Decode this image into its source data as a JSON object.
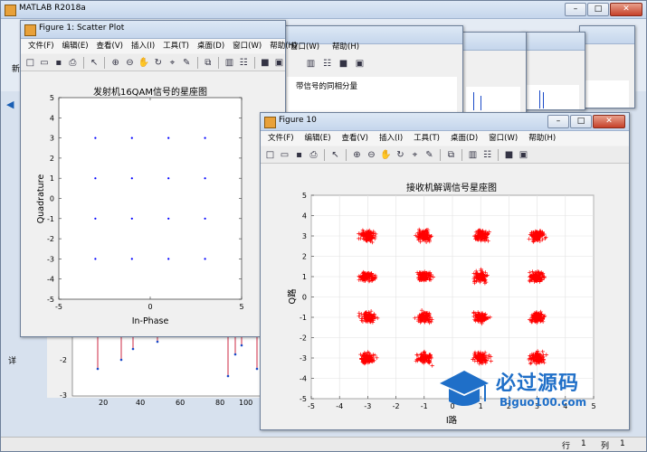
{
  "app": {
    "title": "MATLAB R2018a",
    "side_text": "新",
    "side_text2": "详"
  },
  "statusbar": {
    "row_label": "行",
    "row_value": "1",
    "col_label": "列",
    "col_value": "1"
  },
  "menu": {
    "file": "文件(F)",
    "edit": "编辑(E)",
    "view": "查看(V)",
    "insert": "插入(I)",
    "tools": "工具(T)",
    "desktop": "桌面(D)",
    "window": "窗口(W)",
    "help": "帮助(H)"
  },
  "bg_window": {
    "window_label": "窗口(W)",
    "help_label": "帮助(H)",
    "title": "带信号的同相分量"
  },
  "bg_stem": {
    "ticks_y": [
      "-2",
      "-3"
    ],
    "ticks_x": [
      "20",
      "40",
      "60",
      "80",
      "100"
    ]
  },
  "figure1": {
    "title": "Figure 1: Scatter Plot",
    "chart_data": {
      "type": "scatter",
      "title": "发射机16QAM信号的星座图",
      "xlabel": "In-Phase",
      "ylabel": "Quadrature",
      "xlim": [
        -5,
        5
      ],
      "ylim": [
        -5,
        5
      ],
      "xticks": [
        "-5",
        "0",
        "5"
      ],
      "yticks": [
        "5",
        "4",
        "3",
        "2",
        "1",
        "0",
        "-1",
        "-2",
        "-3",
        "-4",
        "-5"
      ],
      "x": [
        -3,
        -1,
        1,
        3,
        -3,
        -1,
        1,
        3,
        -3,
        -1,
        1,
        3,
        -3,
        -1,
        1,
        3
      ],
      "y": [
        3,
        3,
        3,
        3,
        1,
        1,
        1,
        1,
        -1,
        -1,
        -1,
        -1,
        -3,
        -3,
        -3,
        -3
      ],
      "color": "#0000ff"
    }
  },
  "figure10": {
    "title": "Figure 10",
    "chart_data": {
      "type": "scatter",
      "title": "接收机解调信号星座图",
      "xlabel": "I路",
      "ylabel": "Q路",
      "xlim": [
        -5,
        5
      ],
      "ylim": [
        -5,
        5
      ],
      "xticks": [
        "-5",
        "-4",
        "-3",
        "-2",
        "-1",
        "0",
        "1",
        "2",
        "3",
        "4",
        "5"
      ],
      "yticks": [
        "5",
        "4",
        "3",
        "2",
        "1",
        "0",
        "-1",
        "-2",
        "-3",
        "-4",
        "-5"
      ],
      "cluster_centers_x": [
        -3,
        -1,
        1,
        3,
        -3,
        -1,
        1,
        3,
        -3,
        -1,
        1,
        3,
        -3,
        -1,
        1,
        3
      ],
      "cluster_centers_y": [
        3,
        3,
        3,
        3,
        1,
        1,
        1,
        1,
        -1,
        -1,
        -1,
        -1,
        -3,
        -3,
        -3,
        -3
      ],
      "cluster_spread": 0.25,
      "marker": "+",
      "color": "#ff0000"
    }
  },
  "watermark": {
    "brand": "必过源码",
    "url": "Biguo100.com"
  }
}
